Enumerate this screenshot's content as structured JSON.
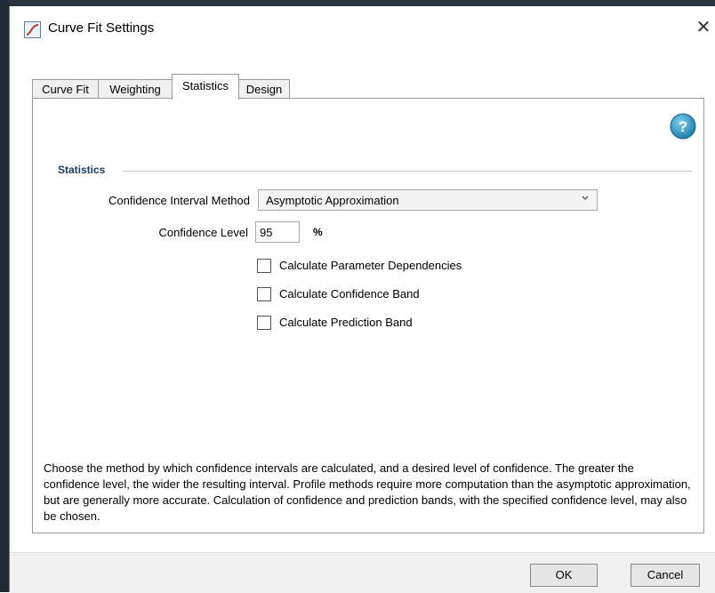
{
  "window": {
    "title": "Curve Fit Settings",
    "close_glyph": "✕"
  },
  "tabs": [
    {
      "label": "Curve Fit",
      "active": false
    },
    {
      "label": "Weighting",
      "active": false
    },
    {
      "label": "Statistics",
      "active": true
    },
    {
      "label": "Design",
      "active": false
    }
  ],
  "statistics": {
    "section_title": "Statistics",
    "ci_method_label": "Confidence Interval Method",
    "ci_method_value": "Asymptotic Approximation",
    "confidence_level_label": "Confidence Level",
    "confidence_level_value": "95",
    "confidence_level_unit": "%",
    "checkboxes": [
      {
        "label": "Calculate Parameter Dependencies",
        "checked": false
      },
      {
        "label": "Calculate Confidence Band",
        "checked": false
      },
      {
        "label": "Calculate Prediction Band",
        "checked": false
      }
    ],
    "description": "Choose the method by which confidence intervals are calculated, and a desired level of confidence. The greater the confidence level, the wider the resulting interval. Profile methods require more computation than the asymptotic approximation, but are generally more accurate. Calculation of confidence and prediction bands, with the specified confidence level, may also be chosen."
  },
  "footer": {
    "ok_label": "OK",
    "cancel_label": "Cancel"
  },
  "icons": {
    "app": "curve-fit-icon",
    "help": "help-icon",
    "dropdown": "chevron-down-icon",
    "close": "close-icon"
  },
  "colors": {
    "help_blue": "#2e8fbf",
    "section_title": "#1a3a6a"
  }
}
